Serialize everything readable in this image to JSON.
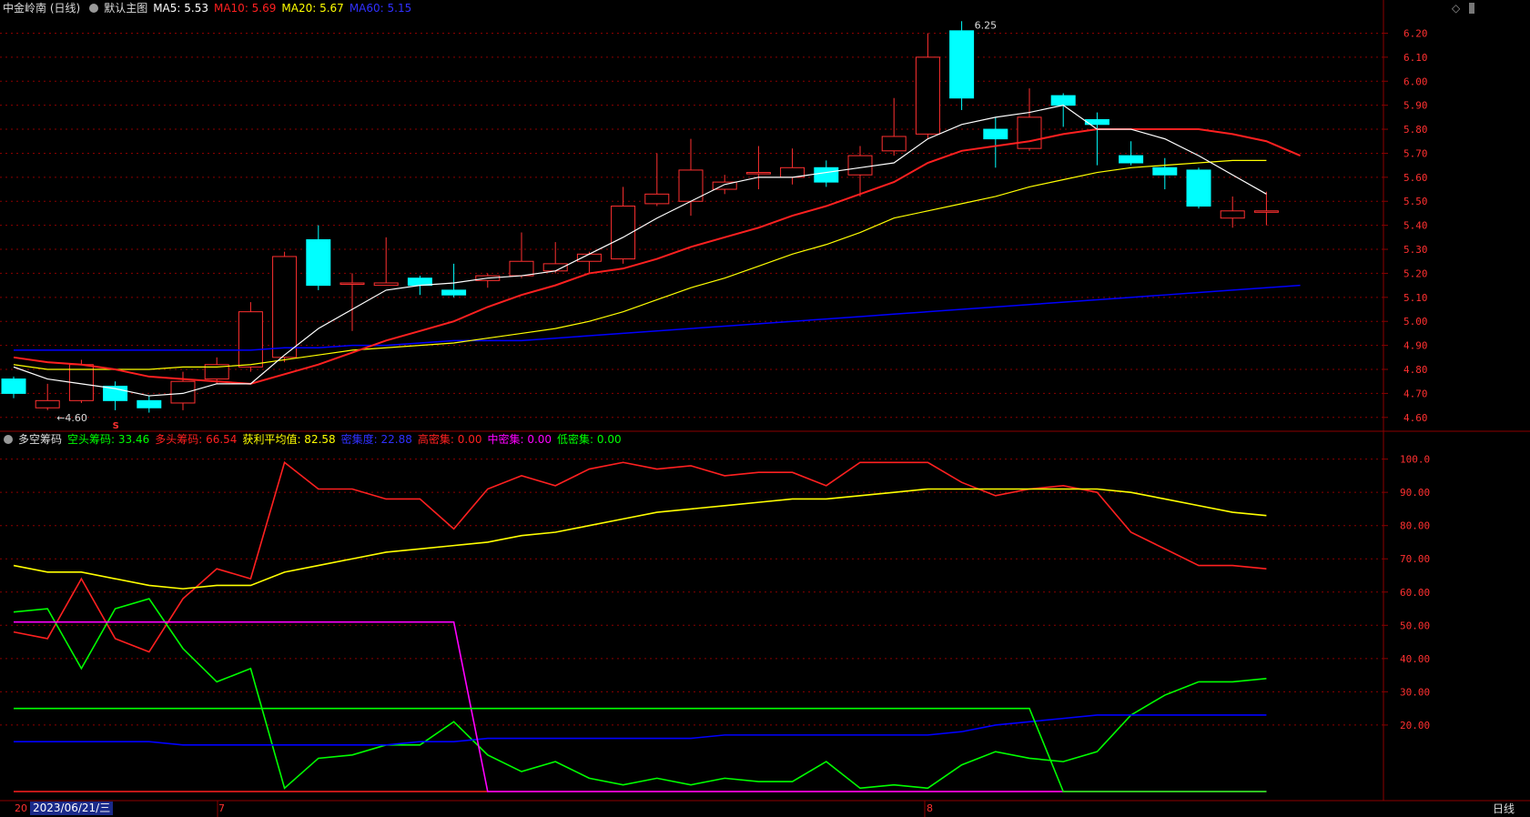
{
  "header": {
    "stock_name": "中金岭南 (日线)",
    "main_chart_label": "默认主图",
    "ma5": "MA5: 5.53",
    "ma10": "MA10: 5.69",
    "ma20": "MA20: 5.67",
    "ma60": "MA60: 5.15"
  },
  "sub_header": {
    "indicator_name": "多空筹码",
    "short_chips": "空头筹码: 33.46",
    "long_chips": "多头筹码: 66.54",
    "profit_avg": "获利平均值: 82.58",
    "concentration": "密集度: 22.88",
    "high_dense": "高密集: 0.00",
    "mid_dense": "中密集: 0.00",
    "low_dense": "低密集: 0.00"
  },
  "bottom_bar": {
    "date_cursor": "2023/06/21/三",
    "month_label_1": "7",
    "month_label_2": "8",
    "left_label": "20",
    "period_button": "日线"
  },
  "annotations": {
    "high_label": "6.25",
    "low_label": "←4.60",
    "signal_mark": "S"
  },
  "colors": {
    "up": "#ff3030",
    "down": "#00ffff",
    "ma5": "#ffffff",
    "ma10": "#ff2020",
    "ma20": "#ffff00",
    "ma60": "#0000ff",
    "grid": "#8b0000",
    "short_line": "#00ff00",
    "long_line": "#ff2020",
    "profit_line": "#ffff00",
    "conc_line": "#0000ff",
    "magenta_line": "#ff00ff"
  },
  "chart_data": [
    {
      "type": "candlestick",
      "y_ticks": [
        "6.20",
        "6.10",
        "6.00",
        "5.90",
        "5.80",
        "5.70",
        "5.60",
        "5.50",
        "5.40",
        "5.30",
        "5.20",
        "5.10",
        "5.00",
        "4.90",
        "4.80",
        "4.70",
        "4.60"
      ],
      "ylim": [
        4.55,
        6.27
      ],
      "candles": [
        {
          "o": 4.76,
          "c": 4.7,
          "h": 4.77,
          "l": 4.68
        },
        {
          "o": 4.64,
          "c": 4.67,
          "h": 4.74,
          "l": 4.63
        },
        {
          "o": 4.67,
          "c": 4.82,
          "h": 4.84,
          "l": 4.66
        },
        {
          "o": 4.73,
          "c": 4.67,
          "h": 4.75,
          "l": 4.63
        },
        {
          "o": 4.67,
          "c": 4.64,
          "h": 4.69,
          "l": 4.62
        },
        {
          "o": 4.66,
          "c": 4.75,
          "h": 4.79,
          "l": 4.63
        },
        {
          "o": 4.76,
          "c": 4.82,
          "h": 4.85,
          "l": 4.74
        },
        {
          "o": 4.81,
          "c": 5.04,
          "h": 5.08,
          "l": 4.79
        },
        {
          "o": 4.85,
          "c": 5.27,
          "h": 5.29,
          "l": 4.83
        },
        {
          "o": 5.34,
          "c": 5.15,
          "h": 5.4,
          "l": 5.13
        },
        {
          "o": 5.16,
          "c": 5.16,
          "h": 5.2,
          "l": 4.96
        },
        {
          "o": 5.15,
          "c": 5.16,
          "h": 5.35,
          "l": 5.15
        },
        {
          "o": 5.18,
          "c": 5.15,
          "h": 5.19,
          "l": 5.11
        },
        {
          "o": 5.13,
          "c": 5.11,
          "h": 5.24,
          "l": 5.1
        },
        {
          "o": 5.17,
          "c": 5.19,
          "h": 5.2,
          "l": 5.14
        },
        {
          "o": 5.19,
          "c": 5.25,
          "h": 5.37,
          "l": 5.18
        },
        {
          "o": 5.21,
          "c": 5.24,
          "h": 5.33,
          "l": 5.2
        },
        {
          "o": 5.25,
          "c": 5.28,
          "h": 5.29,
          "l": 5.2
        },
        {
          "o": 5.26,
          "c": 5.48,
          "h": 5.56,
          "l": 5.24
        },
        {
          "o": 5.49,
          "c": 5.53,
          "h": 5.7,
          "l": 5.48
        },
        {
          "o": 5.5,
          "c": 5.63,
          "h": 5.76,
          "l": 5.44
        },
        {
          "o": 5.55,
          "c": 5.58,
          "h": 5.61,
          "l": 5.53
        },
        {
          "o": 5.62,
          "c": 5.62,
          "h": 5.73,
          "l": 5.55
        },
        {
          "o": 5.6,
          "c": 5.64,
          "h": 5.72,
          "l": 5.57
        },
        {
          "o": 5.64,
          "c": 5.58,
          "h": 5.67,
          "l": 5.56
        },
        {
          "o": 5.61,
          "c": 5.69,
          "h": 5.73,
          "l": 5.52
        },
        {
          "o": 5.71,
          "c": 5.77,
          "h": 5.93,
          "l": 5.69
        },
        {
          "o": 5.78,
          "c": 6.1,
          "h": 6.2,
          "l": 5.76
        },
        {
          "o": 6.21,
          "c": 5.93,
          "h": 6.25,
          "l": 5.88
        },
        {
          "o": 5.8,
          "c": 5.76,
          "h": 5.85,
          "l": 5.64
        },
        {
          "o": 5.72,
          "c": 5.85,
          "h": 5.97,
          "l": 5.71
        },
        {
          "o": 5.94,
          "c": 5.9,
          "h": 5.95,
          "l": 5.81
        },
        {
          "o": 5.84,
          "c": 5.82,
          "h": 5.87,
          "l": 5.65
        },
        {
          "o": 5.69,
          "c": 5.66,
          "h": 5.75,
          "l": 5.65
        },
        {
          "o": 5.64,
          "c": 5.61,
          "h": 5.68,
          "l": 5.55
        },
        {
          "o": 5.63,
          "c": 5.48,
          "h": 5.64,
          "l": 5.47
        },
        {
          "o": 5.43,
          "c": 5.46,
          "h": 5.52,
          "l": 5.39
        },
        {
          "o": 5.46,
          "c": 5.46,
          "h": 5.54,
          "l": 5.4
        }
      ],
      "ma5": [
        4.81,
        4.76,
        4.74,
        4.72,
        4.69,
        4.7,
        4.74,
        4.74,
        4.86,
        4.97,
        5.05,
        5.13,
        5.15,
        5.16,
        5.18,
        5.19,
        5.21,
        5.28,
        5.35,
        5.43,
        5.5,
        5.57,
        5.6,
        5.6,
        5.62,
        5.64,
        5.66,
        5.76,
        5.82,
        5.85,
        5.87,
        5.9,
        5.8,
        5.8,
        5.76,
        5.69,
        5.61,
        5.53
      ],
      "ma10": [
        4.85,
        4.83,
        4.82,
        4.8,
        4.77,
        4.76,
        4.75,
        4.74,
        4.78,
        4.82,
        4.87,
        4.92,
        4.96,
        5.0,
        5.06,
        5.11,
        5.15,
        5.2,
        5.22,
        5.26,
        5.31,
        5.35,
        5.39,
        5.44,
        5.48,
        5.53,
        5.58,
        5.66,
        5.71,
        5.73,
        5.75,
        5.78,
        5.8,
        5.8,
        5.8,
        5.8,
        5.78,
        5.75,
        5.69
      ],
      "ma20": [
        4.82,
        4.8,
        4.8,
        4.8,
        4.8,
        4.81,
        4.81,
        4.82,
        4.84,
        4.86,
        4.88,
        4.89,
        4.9,
        4.91,
        4.93,
        4.95,
        4.97,
        5.0,
        5.04,
        5.09,
        5.14,
        5.18,
        5.23,
        5.28,
        5.32,
        5.37,
        5.43,
        5.46,
        5.49,
        5.52,
        5.56,
        5.59,
        5.62,
        5.64,
        5.65,
        5.66,
        5.67,
        5.67
      ],
      "ma60": [
        4.88,
        4.88,
        4.88,
        4.88,
        4.88,
        4.88,
        4.88,
        4.88,
        4.89,
        4.89,
        4.9,
        4.9,
        4.91,
        4.92,
        4.92,
        4.92,
        4.93,
        4.94,
        4.95,
        4.96,
        4.97,
        4.98,
        4.99,
        5.0,
        5.01,
        5.02,
        5.03,
        5.04,
        5.05,
        5.06,
        5.07,
        5.08,
        5.09,
        5.1,
        5.11,
        5.12,
        5.13,
        5.14,
        5.15
      ]
    },
    {
      "type": "line",
      "y_ticks": [
        "100.0",
        "90.00",
        "80.00",
        "70.00",
        "60.00",
        "50.00",
        "40.00",
        "30.00",
        "20.00"
      ],
      "ylim": [
        0,
        104
      ],
      "series": [
        {
          "name": "多头筹码",
          "values": [
            48,
            46,
            64,
            46,
            42,
            58,
            67,
            64,
            99,
            91,
            91,
            88,
            88,
            79,
            91,
            95,
            92,
            97,
            99,
            97,
            98,
            95,
            96,
            96,
            92,
            99,
            99,
            99,
            93,
            89,
            91,
            92,
            90,
            78,
            73,
            68,
            68,
            67
          ]
        },
        {
          "name": "获利平均值",
          "values": [
            68,
            66,
            66,
            64,
            62,
            61,
            62,
            62,
            66,
            68,
            70,
            72,
            73,
            74,
            75,
            77,
            78,
            80,
            82,
            84,
            85,
            86,
            87,
            88,
            88,
            89,
            90,
            91,
            91,
            91,
            91,
            91,
            91,
            90,
            88,
            86,
            84,
            83
          ]
        },
        {
          "name": "空头筹码",
          "values": [
            54,
            55,
            37,
            55,
            58,
            43,
            33,
            37,
            1,
            10,
            11,
            14,
            14,
            21,
            11,
            6,
            9,
            4,
            2,
            4,
            2,
            4,
            3,
            3,
            9,
            1,
            2,
            1,
            8,
            12,
            10,
            9,
            12,
            23,
            29,
            33,
            33,
            34
          ]
        },
        {
          "name": "密集度",
          "values": [
            15,
            15,
            15,
            15,
            15,
            14,
            14,
            14,
            14,
            14,
            14,
            14,
            15,
            15,
            16,
            16,
            16,
            16,
            16,
            16,
            16,
            17,
            17,
            17,
            17,
            17,
            17,
            17,
            18,
            20,
            21,
            22,
            23,
            23,
            23,
            23,
            23,
            23
          ]
        },
        {
          "name": "高密集",
          "values": [
            0,
            0,
            0,
            0,
            0,
            0,
            0,
            0,
            0,
            0,
            0,
            0,
            0,
            0,
            0,
            0,
            0,
            0,
            0,
            0,
            0,
            0,
            0,
            0,
            0,
            0,
            0,
            0,
            0,
            0,
            0,
            0,
            0,
            0,
            0,
            0,
            0,
            0
          ]
        },
        {
          "name": "中密集",
          "values": [
            51,
            51,
            51,
            51,
            51,
            51,
            51,
            51,
            51,
            51,
            51,
            51,
            51,
            51,
            0,
            0,
            0,
            0,
            0,
            0,
            0,
            0,
            0,
            0,
            0,
            0,
            0,
            0,
            0,
            0,
            0,
            0,
            0,
            0,
            0,
            0,
            0,
            0
          ]
        },
        {
          "name": "低密集",
          "values": [
            25,
            25,
            25,
            25,
            25,
            25,
            25,
            25,
            25,
            25,
            25,
            25,
            25,
            25,
            25,
            25,
            25,
            25,
            25,
            25,
            25,
            25,
            25,
            25,
            25,
            25,
            25,
            25,
            25,
            25,
            25,
            0,
            0,
            0,
            0,
            0,
            0,
            0
          ]
        }
      ]
    }
  ]
}
